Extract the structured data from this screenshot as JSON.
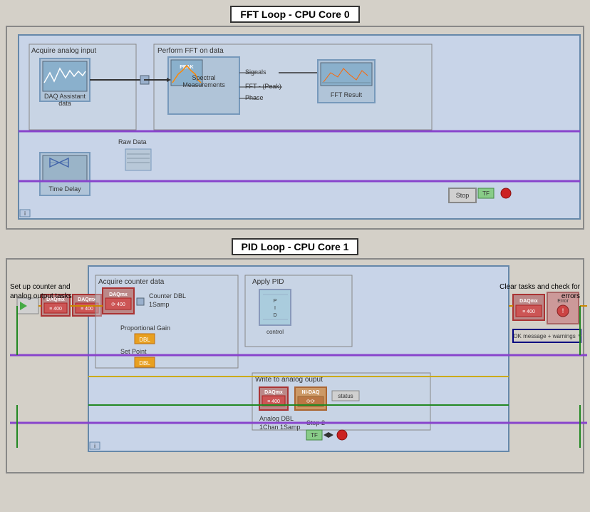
{
  "fft_loop": {
    "title": "FFT Loop - CPU Core 0",
    "acquire_label": "Acquire analog input",
    "perform_label": "Perform FFT on data",
    "daq_assistant_label": "DAQ Assistant",
    "daq_assistant_sub": "data",
    "raw_data_label": "Raw Data",
    "spectral_label": "Spectral Measurements",
    "signals_label": "Signals",
    "fft_peak_label": "FFT - (Peak)",
    "phase_label": "Phase",
    "fft_result_label": "FFT Result",
    "time_delay_label": "Time Delay",
    "stop_label": "Stop",
    "tf_label": "TF",
    "loop_badge": "i"
  },
  "pid_loop": {
    "title": "PID Loop - CPU Core 1",
    "setup_label": "Set up counter and\nanalog output tasks",
    "clear_label": "Clear tasks and\ncheck for errors",
    "acquire_counter_label": "Acquire counter data",
    "apply_pid_label": "Apply PID",
    "write_analog_label": "Write to analog ouput",
    "counter_dbl_label": "Counter DBL\n1Samp",
    "proportional_gain_label": "Proportional Gain",
    "dbl1_label": "DBL",
    "set_point_label": "Set Point",
    "dbl2_label": "DBL",
    "analog_dbl_label": "Analog DBL\n1Chan 1Samp",
    "stop2_label": "Stop 2",
    "tf2_label": "TF",
    "status_label": "status",
    "ok_message_label": "OK message + warnings",
    "loop_badge": "i"
  }
}
